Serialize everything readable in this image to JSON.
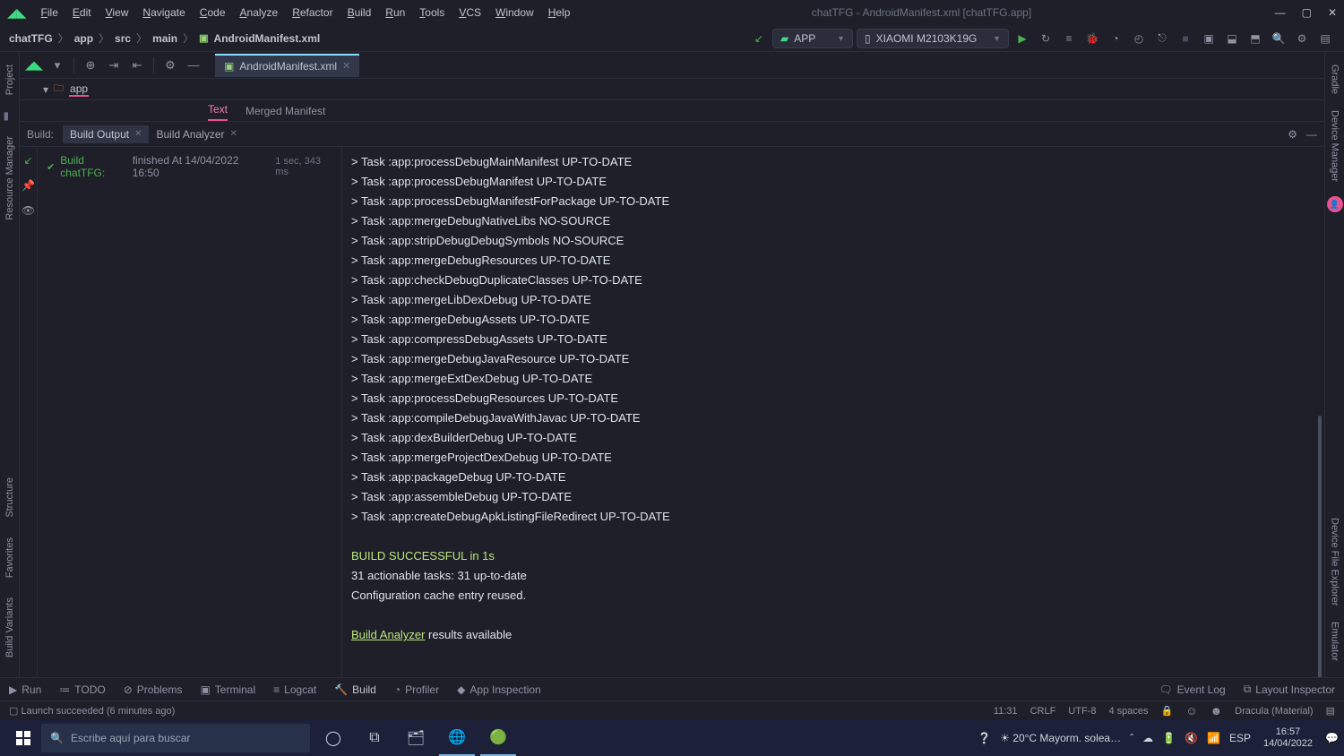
{
  "titleBar": {
    "menu": [
      "File",
      "Edit",
      "View",
      "Navigate",
      "Code",
      "Analyze",
      "Refactor",
      "Build",
      "Run",
      "Tools",
      "VCS",
      "Window",
      "Help"
    ],
    "title": "chatTFG - AndroidManifest.xml [chatTFG.app]"
  },
  "breadcrumb": [
    "chatTFG",
    "app",
    "src",
    "main",
    "AndroidManifest.xml"
  ],
  "runConfig": {
    "app": "APP",
    "device": "XIAOMI M2103K19G"
  },
  "fileTab": {
    "name": "AndroidManifest.xml"
  },
  "project": {
    "module": "app",
    "triangle": "▾"
  },
  "subTabs": {
    "text": "Text",
    "merged": "Merged Manifest"
  },
  "buildTabs": {
    "label": "Build:",
    "output": "Build Output",
    "analyzer": "Build Analyzer"
  },
  "buildTree": {
    "title": "Build chatTFG:",
    "status": "finished At 14/04/2022 16:50",
    "time": "1 sec, 343 ms"
  },
  "buildOutput": {
    "lines": [
      "> Task :app:processDebugMainManifest UP-TO-DATE",
      "> Task :app:processDebugManifest UP-TO-DATE",
      "> Task :app:processDebugManifestForPackage UP-TO-DATE",
      "> Task :app:mergeDebugNativeLibs NO-SOURCE",
      "> Task :app:stripDebugDebugSymbols NO-SOURCE",
      "> Task :app:mergeDebugResources UP-TO-DATE",
      "> Task :app:checkDebugDuplicateClasses UP-TO-DATE",
      "> Task :app:mergeLibDexDebug UP-TO-DATE",
      "> Task :app:mergeDebugAssets UP-TO-DATE",
      "> Task :app:compressDebugAssets UP-TO-DATE",
      "> Task :app:mergeDebugJavaResource UP-TO-DATE",
      "> Task :app:mergeExtDexDebug UP-TO-DATE",
      "> Task :app:processDebugResources UP-TO-DATE",
      "> Task :app:compileDebugJavaWithJavac UP-TO-DATE",
      "> Task :app:dexBuilderDebug UP-TO-DATE",
      "> Task :app:mergeProjectDexDebug UP-TO-DATE",
      "> Task :app:packageDebug UP-TO-DATE",
      "> Task :app:assembleDebug UP-TO-DATE",
      "> Task :app:createDebugApkListingFileRedirect UP-TO-DATE"
    ],
    "success": "BUILD SUCCESSFUL in 1s",
    "summary1": "31 actionable tasks: 31 up-to-date",
    "summary2": "Configuration cache entry reused.",
    "baLink": "Build Analyzer",
    "baText": " results available"
  },
  "leftStripe": {
    "project": "Project",
    "resmgr": "Resource Manager",
    "structure": "Structure",
    "favorites": "Favorites",
    "bv": "Build Variants"
  },
  "rightStripe": {
    "gradle": "Gradle",
    "devmgr": "Device Manager",
    "dfe": "Device File Explorer",
    "emu": "Emulator"
  },
  "bottomTabs": {
    "run": "Run",
    "todo": "TODO",
    "problems": "Problems",
    "terminal": "Terminal",
    "logcat": "Logcat",
    "build": "Build",
    "profiler": "Profiler",
    "appinsp": "App Inspection",
    "eventlog": "Event Log",
    "layoutinsp": "Layout Inspector"
  },
  "statusBar": {
    "msg": "Launch succeeded (6 minutes ago)",
    "pos": "11:31",
    "crlf": "CRLF",
    "enc": "UTF-8",
    "spaces": "4 spaces",
    "theme": "Dracula (Material)"
  },
  "taskbar": {
    "search": "Escribe aquí para buscar",
    "weather": "20°C  Mayorm. solea…",
    "lang": "ESP",
    "time": "16:57",
    "date": "14/04/2022"
  }
}
